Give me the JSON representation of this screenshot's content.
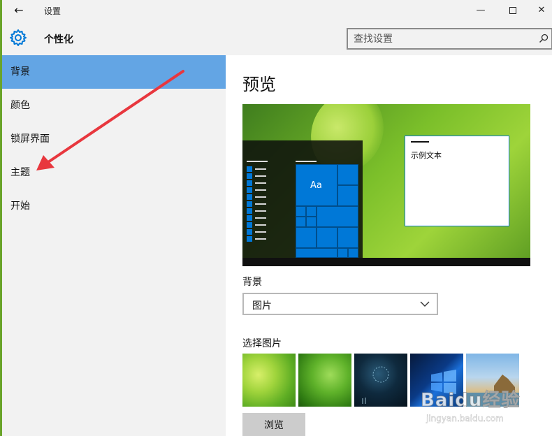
{
  "titlebar": {
    "back_glyph": "←",
    "title": "设置",
    "minimize_glyph": "—",
    "close_glyph": "✕"
  },
  "header": {
    "page_title": "个性化",
    "icon": "gear-icon",
    "accent_color": "#0078d7"
  },
  "search": {
    "placeholder": "查找设置",
    "icon": "search-icon"
  },
  "sidebar": {
    "items": [
      {
        "label": "背景",
        "active": true
      },
      {
        "label": "颜色",
        "active": false
      },
      {
        "label": "锁屏界面",
        "active": false
      },
      {
        "label": "主题",
        "active": false
      },
      {
        "label": "开始",
        "active": false
      }
    ],
    "active_color": "#63a5e4"
  },
  "main": {
    "preview_heading": "预览",
    "preview": {
      "tile_label": "Aa",
      "sample_text": "示例文本"
    },
    "background_label": "背景",
    "background_dropdown": {
      "selected": "图片"
    },
    "choose_picture_label": "选择图片",
    "browse_button": "浏览"
  },
  "watermark": {
    "logo": "Baidu经验",
    "url": "jingyan.baidu.com"
  },
  "annotation": {
    "arrow_color": "#e8373e"
  }
}
